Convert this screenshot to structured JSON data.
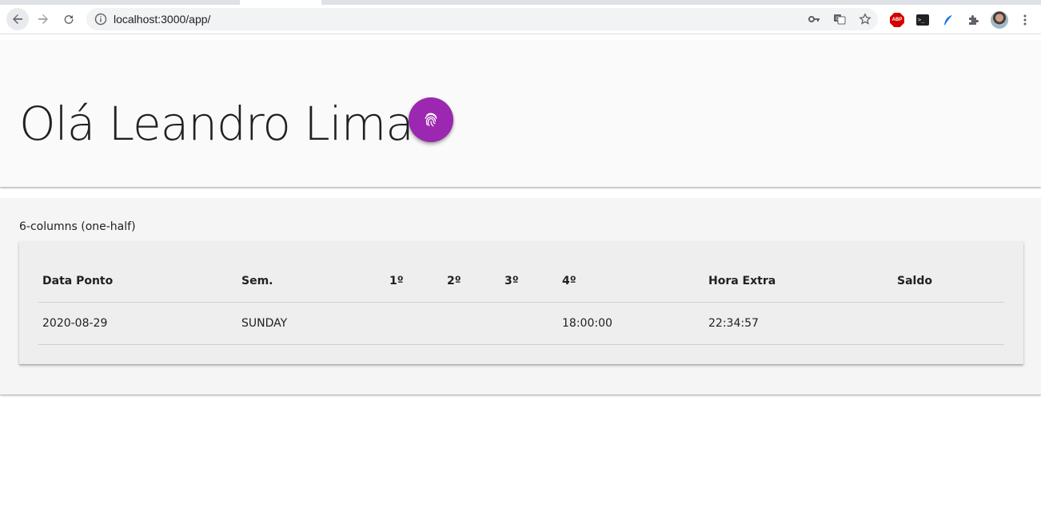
{
  "browser": {
    "url": "localhost:3000/app/",
    "icons": {
      "back": "arrow-left-icon",
      "forward": "arrow-right-icon",
      "reload": "reload-icon",
      "site_info": "info-icon",
      "key": "key-icon",
      "translate": "translate-icon",
      "bookmark": "star-icon",
      "adblock": "abp-icon",
      "terminal": "terminal-icon",
      "feather": "feather-icon",
      "extensions": "puzzle-icon",
      "profile": "avatar",
      "menu": "kebab-menu-icon"
    },
    "abp_label": "ABP"
  },
  "header": {
    "greeting": "Olá Leandro Lima",
    "fab_icon": "fingerprint-icon",
    "fab_color": "#9c27b0"
  },
  "section": {
    "caption": "6-columns (one-half)"
  },
  "table": {
    "columns": [
      "Data Ponto",
      "Sem.",
      "1º",
      "2º",
      "3º",
      "4º",
      "Hora Extra",
      "Saldo"
    ],
    "rows": [
      [
        "2020-08-29",
        "SUNDAY",
        "",
        "",
        "",
        "18:00:00",
        "22:34:57",
        ""
      ]
    ]
  }
}
